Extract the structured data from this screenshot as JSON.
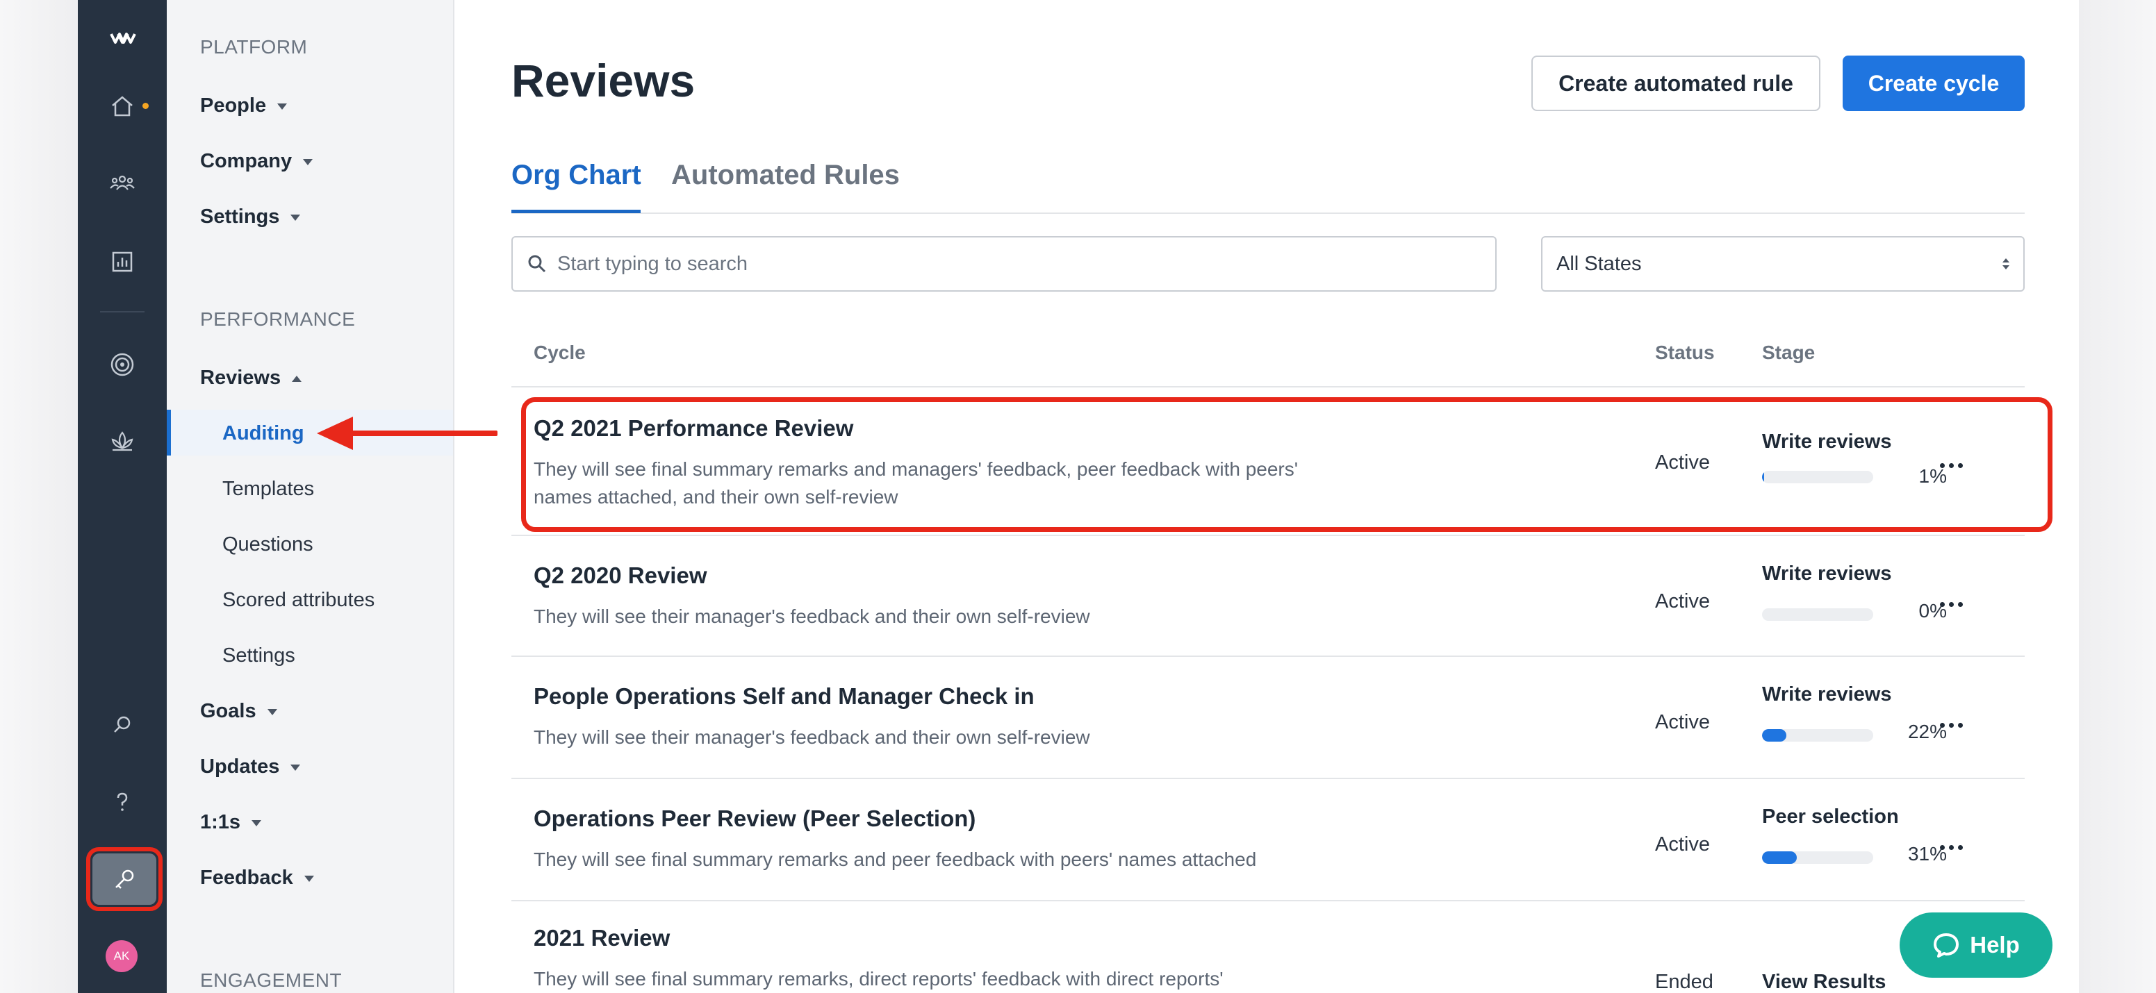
{
  "sidebar": {
    "platform_section": "PLATFORM",
    "platform_items": [
      "People",
      "Company",
      "Settings"
    ],
    "performance_section": "PERFORMANCE",
    "reviews_label": "Reviews",
    "reviews_subitems": [
      "Auditing",
      "Templates",
      "Questions",
      "Scored attributes",
      "Settings"
    ],
    "more_items": [
      "Goals",
      "Updates",
      "1:1s",
      "Feedback"
    ],
    "engagement_section": "ENGAGEMENT"
  },
  "rail": {
    "avatar_initials": "AK"
  },
  "header": {
    "title": "Reviews",
    "create_rule_label": "Create automated rule",
    "create_cycle_label": "Create cycle"
  },
  "tabs": [
    "Org Chart",
    "Automated Rules"
  ],
  "search": {
    "placeholder": "Start typing to search"
  },
  "state_filter": {
    "selected": "All States"
  },
  "table": {
    "columns": [
      "Cycle",
      "Status",
      "Stage"
    ],
    "rows": [
      {
        "name": "Q2 2021 Performance Review",
        "description": "They will see final summary remarks and managers' feedback, peer feedback with peers' names attached, and their own self-review",
        "status": "Active",
        "stage": "Write reviews",
        "progress_label": "1%",
        "progress": 0.01
      },
      {
        "name": "Q2 2020 Review",
        "description": "They will see their manager's feedback and their own self-review",
        "status": "Active",
        "stage": "Write reviews",
        "progress_label": "0%",
        "progress": 0
      },
      {
        "name": "People Operations Self and Manager Check in",
        "description": "They will see their manager's feedback and their own self-review",
        "status": "Active",
        "stage": "Write reviews",
        "progress_label": "22%",
        "progress": 0.22
      },
      {
        "name": "Operations Peer Review (Peer Selection)",
        "description": "They will see final summary remarks and peer feedback with peers' names attached",
        "status": "Active",
        "stage": "Peer selection",
        "progress_label": "31%",
        "progress": 0.31
      },
      {
        "name": "2021 Review",
        "description": "They will see final summary remarks, direct reports' feedback with direct reports'",
        "status": "Ended",
        "stage": "View Results"
      }
    ]
  },
  "help": {
    "label": "Help"
  },
  "colors": {
    "accent": "#1f75e0",
    "rail": "#263241",
    "annotation": "#e8281a",
    "help": "#17b09b"
  }
}
